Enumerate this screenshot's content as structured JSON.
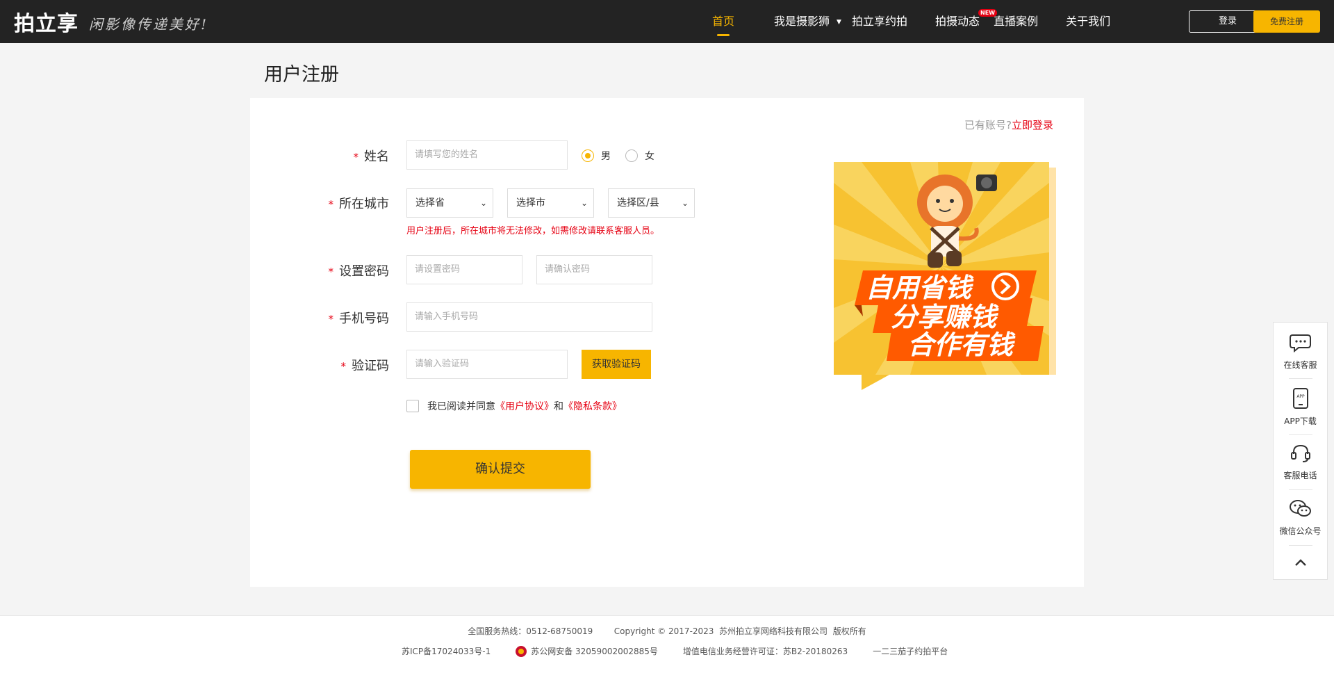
{
  "header": {
    "logo_text": "拍立享",
    "slogan": "闲影像传递美好!",
    "nav": [
      {
        "label": "首页",
        "active": true
      },
      {
        "label": "我是摄影狮",
        "has_dropdown": true
      },
      {
        "label": "拍立享约拍"
      },
      {
        "label": "拍摄动态",
        "badge": "NEW"
      },
      {
        "label": "直播案例"
      },
      {
        "label": "关于我们"
      }
    ],
    "login_label": "登录",
    "register_label": "免费注册"
  },
  "page_title": "用户注册",
  "form": {
    "have_account": "已有账号?",
    "login_now": "立即登录",
    "name_label": "姓名",
    "name_placeholder": "请填写您的姓名",
    "gender_male": "男",
    "gender_female": "女",
    "gender_selected": "男",
    "city_label": "所在城市",
    "province": "选择省",
    "city": "选择市",
    "district": "选择区/县",
    "city_hint": "用户注册后，所在城市将无法修改，如需修改请联系客服人员。",
    "password_label": "设置密码",
    "password_placeholder": "请设置密码",
    "confirm_placeholder": "请确认密码",
    "phone_label": "手机号码",
    "phone_placeholder": "请输入手机号码",
    "code_label": "验证码",
    "code_placeholder": "请输入验证码",
    "get_code": "获取验证码",
    "agree_prefix": "我已阅读并同意",
    "user_agreement": "《用户协议》",
    "agree_and": "和",
    "privacy": "《隐私条款》",
    "submit": "确认提交",
    "required_mark": "*"
  },
  "promo": {
    "line1": "自用省钱",
    "line2": "分享赚钱",
    "line3": "合作有钱",
    "colors": {
      "bg": "#f7c231",
      "ribbon": "#ff5a00"
    }
  },
  "sidebar": {
    "online_service": "在线客服",
    "app_download": "APP下载",
    "app_icon_text": "APP",
    "service_phone": "客服电话",
    "wechat": "微信公众号"
  },
  "footer": {
    "row1": "全国服务热线：0512-68750019        Copyright © 2017-2023  苏州拍立享网络科技有限公司  版权所有",
    "icp": "苏ICP备17024033号-1",
    "police": "苏公网安备 32059002002885号",
    "telecom": "增值电信业务经营许可证：苏B2-20180263",
    "platform": "一二三茄子约拍平台"
  },
  "colors": {
    "accent": "#f7b500",
    "header_bg": "#232323",
    "required": "#e60012"
  }
}
